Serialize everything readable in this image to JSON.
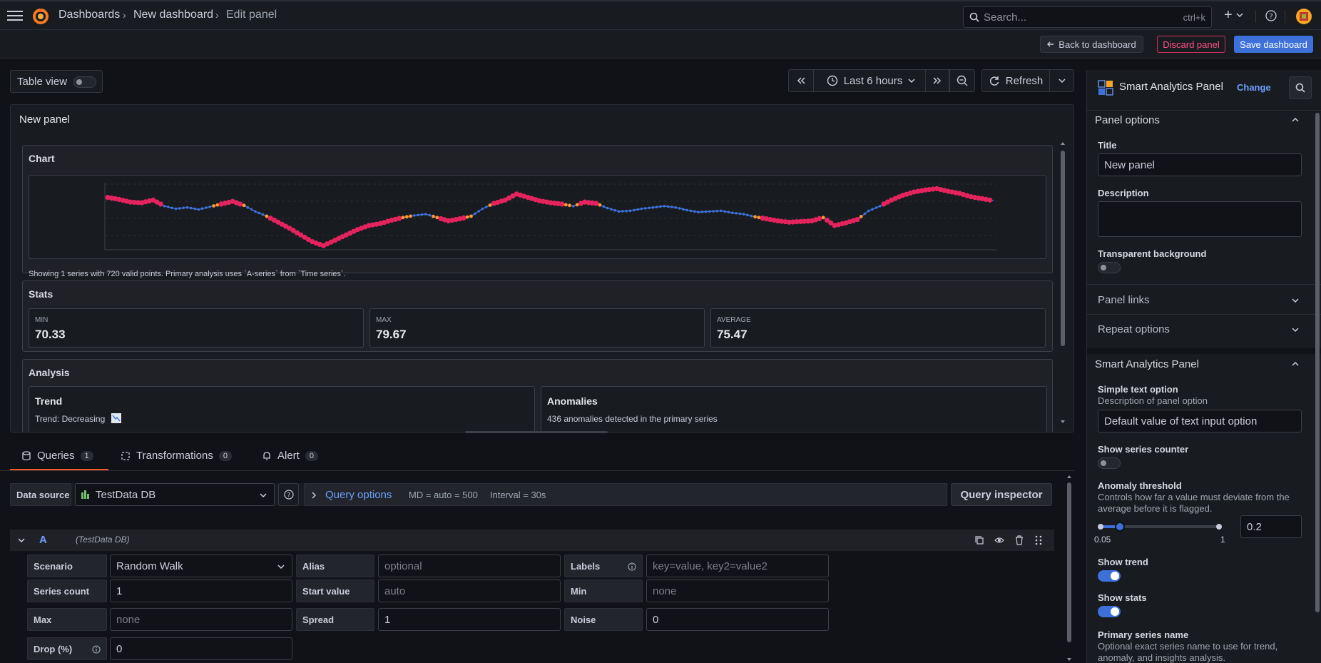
{
  "topbar": {
    "breadcrumbs": [
      "Dashboards",
      "New dashboard",
      "Edit panel"
    ],
    "search_placeholder": "Search...",
    "search_shortcut": "ctrl+k",
    "plus_label": "+"
  },
  "actions": {
    "back": "Back to dashboard",
    "discard": "Discard panel",
    "save": "Save dashboard"
  },
  "toolbar": {
    "table_view": "Table view",
    "time_range": "Last 6 hours",
    "refresh": "Refresh"
  },
  "panel": {
    "title": "New panel",
    "chart_section": "Chart",
    "chart_caption": "Showing 1 series with 720 valid points. Primary analysis uses `A-series` from `Time series`.",
    "stats_section": "Stats",
    "stats": [
      {
        "label": "MIN",
        "value": "70.33"
      },
      {
        "label": "MAX",
        "value": "79.67"
      },
      {
        "label": "AVERAGE",
        "value": "75.47"
      }
    ],
    "analysis_section": "Analysis",
    "trend_title": "Trend",
    "trend_text": "Trend: Decreasing",
    "anomalies_title": "Anomalies",
    "anomalies_text": "436 anomalies detected in the primary series"
  },
  "chart_data": {
    "type": "scatter",
    "title": "",
    "xlabel": "",
    "ylabel": "",
    "ylim": [
      70,
      80
    ],
    "series": [
      {
        "values": [
          77.6,
          77.3,
          76.9,
          76.8,
          77.2,
          76.3,
          75.9,
          76.1,
          75.8,
          76.2,
          76.6,
          77.0,
          76.4,
          75.5,
          74.8,
          73.9,
          73.0,
          72.0,
          71.0,
          70.4,
          71.2,
          72.0,
          72.8,
          73.4,
          73.7,
          74.2,
          74.6,
          74.9,
          75.1,
          74.6,
          74.1,
          74.4,
          74.8,
          75.9,
          76.7,
          77.2,
          78.1,
          77.6,
          77.1,
          76.8,
          76.6,
          76.3,
          76.9,
          76.7,
          76.0,
          75.5,
          75.6,
          75.9,
          76.1,
          76.3,
          76.1,
          75.7,
          75.4,
          75.5,
          75.6,
          75.3,
          75.1,
          74.7,
          74.4,
          74.1,
          73.9,
          74.0,
          74.1,
          74.6,
          73.4,
          73.8,
          74.3,
          75.6,
          76.3,
          77.2,
          77.9,
          78.4,
          78.7,
          78.9,
          78.5,
          78.2,
          77.7,
          77.4,
          77.1
        ]
      }
    ],
    "anomaly_color": "#e5245f",
    "normal_color": "#3d71d9",
    "highlight_color": "#ff9830"
  },
  "tabs": [
    {
      "label": "Queries",
      "count": "1"
    },
    {
      "label": "Transformations",
      "count": "0"
    },
    {
      "label": "Alert",
      "count": "0"
    }
  ],
  "query": {
    "datasource_label": "Data source",
    "datasource": "TestData DB",
    "options_label": "Query options",
    "md": "MD = auto = 500",
    "interval": "Interval = 30s",
    "inspector": "Query inspector",
    "ref_id": "A",
    "ref_ds": "(TestData DB)",
    "fields": {
      "scenario_label": "Scenario",
      "scenario": "Random Walk",
      "alias_label": "Alias",
      "alias_ph": "optional",
      "labels_label": "Labels",
      "labels_ph": "key=value, key2=value2",
      "series_count_label": "Series count",
      "series_count": "1",
      "start_value_label": "Start value",
      "start_value_ph": "auto",
      "min_label": "Min",
      "min_ph": "none",
      "max_label": "Max",
      "max_ph": "none",
      "spread_label": "Spread",
      "spread": "1",
      "noise_label": "Noise",
      "noise": "0",
      "drop_label": "Drop (%)",
      "drop": "0"
    }
  },
  "sidebar": {
    "viz_name": "Smart Analytics Panel",
    "change": "Change",
    "panel_options": "Panel options",
    "title_label": "Title",
    "title_value": "New panel",
    "description_label": "Description",
    "transparent_label": "Transparent background",
    "panel_links": "Panel links",
    "repeat_options": "Repeat options",
    "section2": "Smart Analytics Panel",
    "simple_text_label": "Simple text option",
    "simple_text_desc": "Description of panel option",
    "simple_text_value": "Default value of text input option",
    "show_counter_label": "Show series counter",
    "anomaly_label": "Anomaly threshold",
    "anomaly_desc": "Controls how far a value must deviate from the average before it is flagged.",
    "slider_min": "0.05",
    "slider_max": "1",
    "slider_value": "0.2",
    "slider_fraction": 0.16,
    "show_trend_label": "Show trend",
    "show_stats_label": "Show stats",
    "primary_label": "Primary series name",
    "primary_desc": "Optional exact series name to use for trend, anomaly, and insights analysis."
  }
}
